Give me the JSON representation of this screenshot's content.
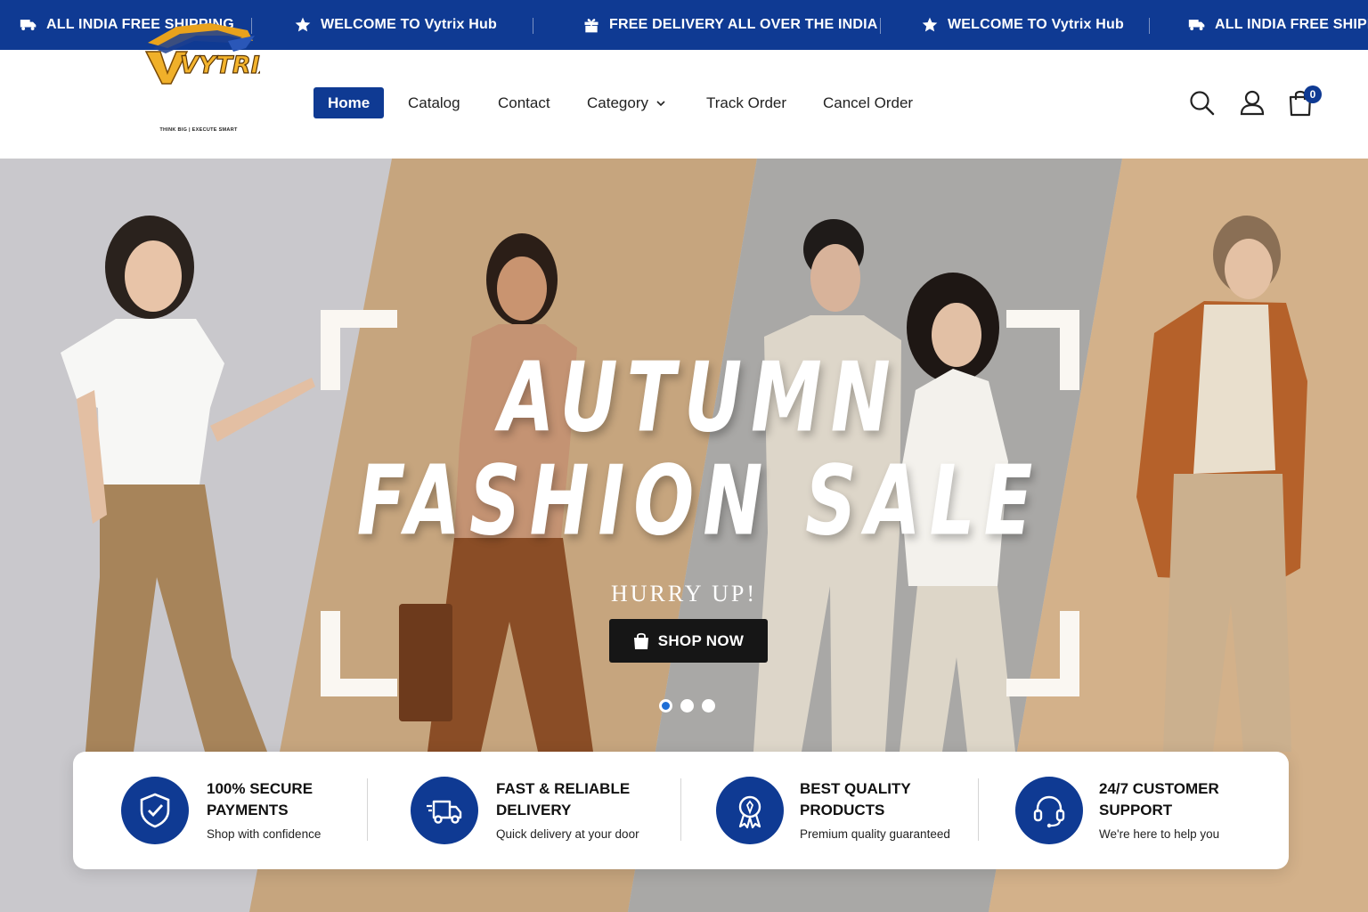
{
  "announcements": [
    {
      "icon": "truck-icon",
      "text": "ALL INDIA FREE SHIPPING"
    },
    {
      "icon": "star-icon",
      "text": "WELCOME TO Vytrix Hub"
    },
    {
      "icon": "gift-icon",
      "text": "FREE DELIVERY ALL OVER THE INDIA"
    },
    {
      "icon": "star-icon",
      "text": "WELCOME TO Vytrix Hub"
    },
    {
      "icon": "truck-icon",
      "text": "ALL INDIA FREE SHIPPIN"
    }
  ],
  "brand": {
    "logo_text": "VYTRIX",
    "tagline": "THINK BIG | EXECUTE SMART"
  },
  "nav": {
    "home": "Home",
    "catalog": "Catalog",
    "contact": "Contact",
    "category": "Category",
    "track": "Track Order",
    "cancel": "Cancel Order"
  },
  "header_icons": [
    "search-icon",
    "user-icon",
    "shopping-bag-icon"
  ],
  "cart": {
    "count": "0"
  },
  "hero": {
    "title_line1": "AUTUMN",
    "title_line2": "FASHION SALE",
    "subtitle": "HURRY UP!",
    "cta": "SHOP NOW",
    "slides": 3,
    "active_slide": 1
  },
  "features": [
    {
      "icon": "shield-check-icon",
      "title1": "100% SECURE",
      "title2": "PAYMENTS",
      "subtitle": "Shop with confidence"
    },
    {
      "icon": "delivery-truck-icon",
      "title1": "FAST & RELIABLE",
      "title2": "DELIVERY",
      "subtitle": "Quick delivery at your door"
    },
    {
      "icon": "award-badge-icon",
      "title1": "BEST QUALITY",
      "title2": "PRODUCTS",
      "subtitle": "Premium quality guaranteed"
    },
    {
      "icon": "headset-icon",
      "title1": "24/7 CUSTOMER",
      "title2": "SUPPORT",
      "subtitle": "We're here to help you"
    }
  ],
  "colors": {
    "primary": "#0f3a93",
    "dark_button": "#161616",
    "active_dot": "#1f6fd6"
  }
}
